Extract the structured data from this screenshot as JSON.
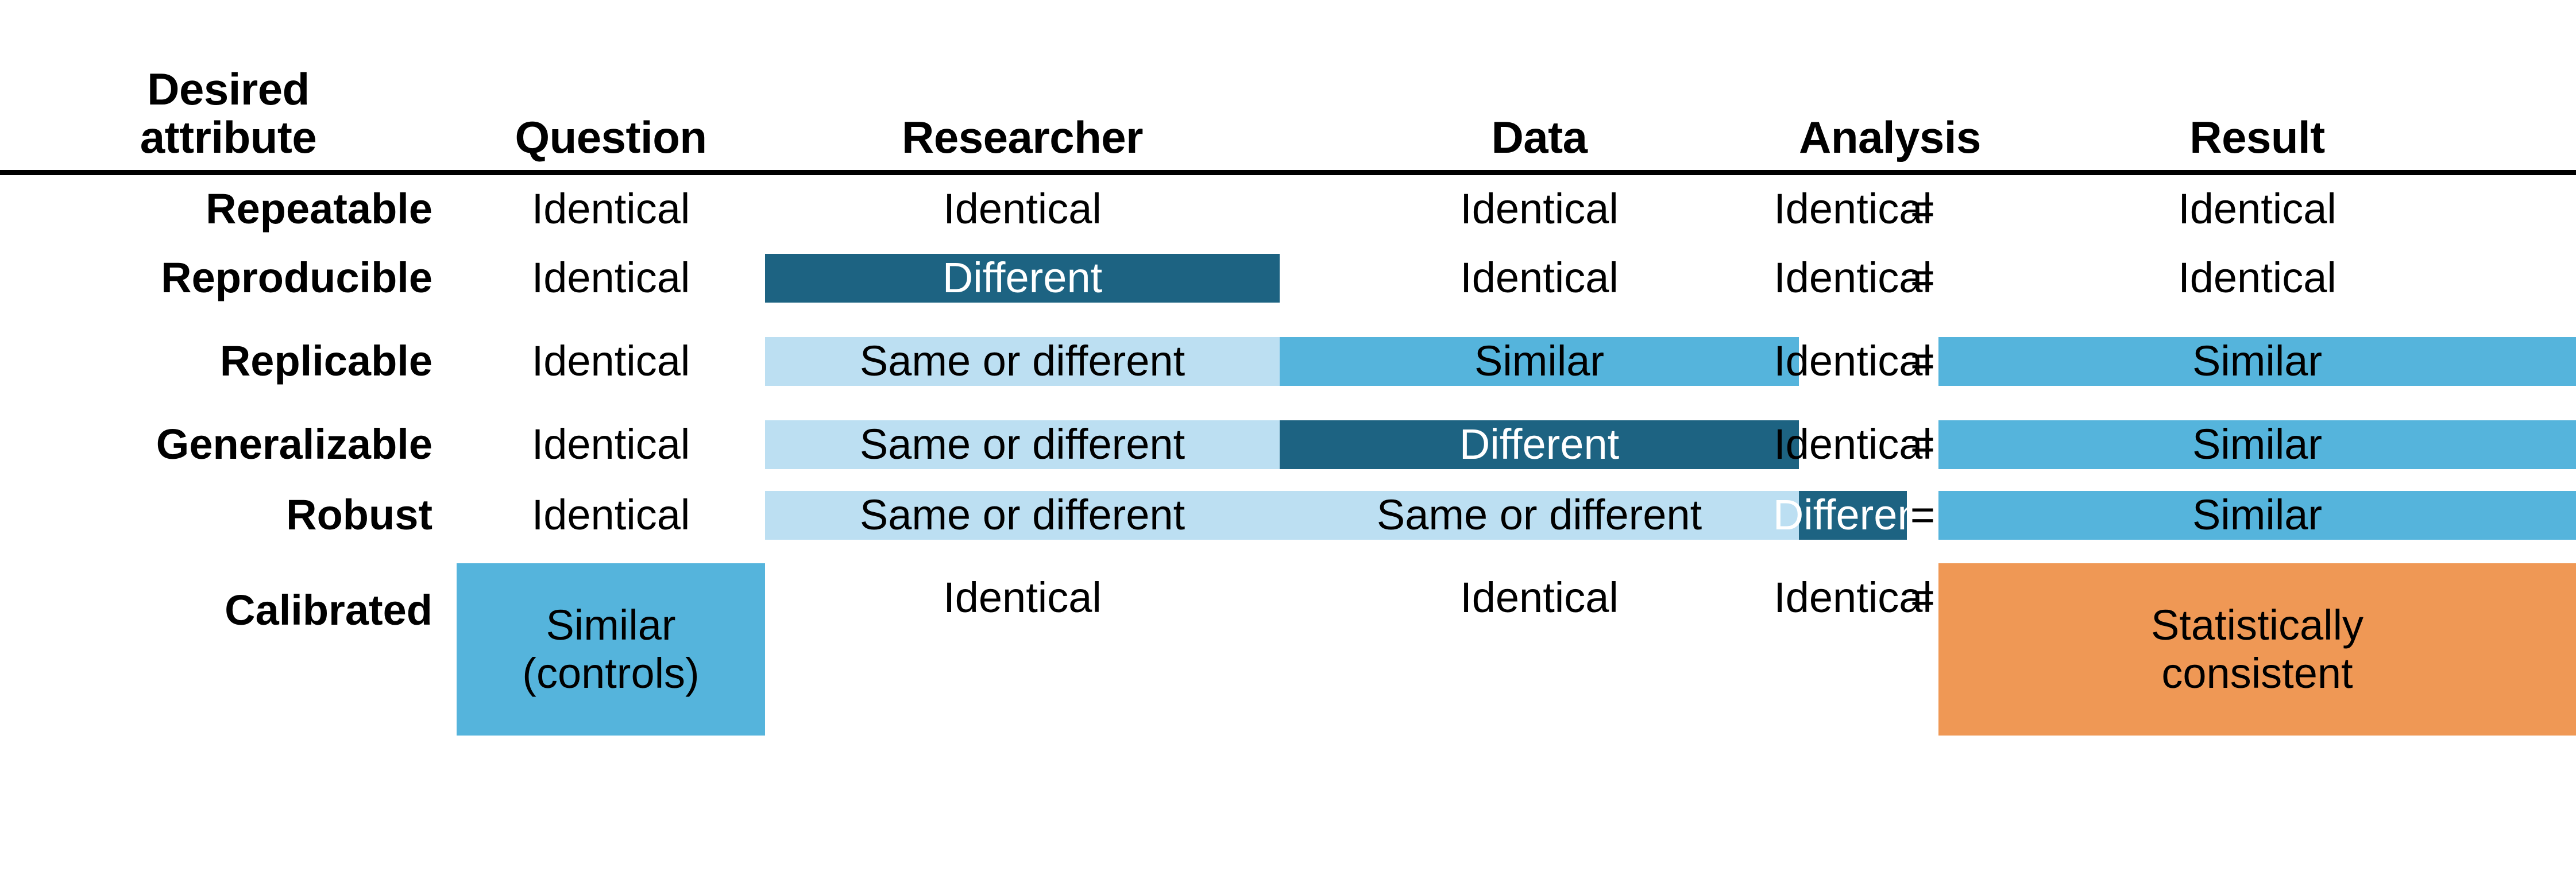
{
  "table": {
    "columns": [
      {
        "id": "attribute",
        "label": "Desired\nattribute",
        "label_line1": "Desired",
        "label_line2": "attribute"
      },
      {
        "id": "question",
        "label": "Question"
      },
      {
        "id": "researcher",
        "label": "Researcher"
      },
      {
        "id": "data",
        "label": "Data"
      },
      {
        "id": "analysis",
        "label": "Analysis"
      },
      {
        "id": "equals",
        "label": ""
      },
      {
        "id": "result",
        "label": "Result"
      }
    ],
    "equals_symbol": "=",
    "colors": {
      "dark_teal": "#1d6382",
      "medium_blue": "#55b4dc",
      "light_blue": "#bcdff2",
      "orange": "#ef9855",
      "text": "#000000",
      "text_on_dark": "#ffffff",
      "rule": "#000000",
      "background": "#ffffff"
    },
    "rows": [
      {
        "attribute": "Repeatable",
        "question": {
          "text": "Identical",
          "fill": "none"
        },
        "researcher": {
          "text": "Identical",
          "fill": "none"
        },
        "data": {
          "text": "Identical",
          "fill": "none"
        },
        "analysis": {
          "text": "Identical",
          "fill": "none"
        },
        "equals": "=",
        "result": {
          "text": "Identical",
          "fill": "none"
        }
      },
      {
        "attribute": "Reproducible",
        "question": {
          "text": "Identical",
          "fill": "none"
        },
        "researcher": {
          "text": "Different",
          "fill": "dark"
        },
        "data": {
          "text": "Identical",
          "fill": "none"
        },
        "analysis": {
          "text": "Identical",
          "fill": "none"
        },
        "equals": "=",
        "result": {
          "text": "Identical",
          "fill": "none"
        }
      },
      {
        "attribute": "Replicable",
        "question": {
          "text": "Identical",
          "fill": "none"
        },
        "researcher": {
          "text": "Same or different",
          "fill": "light"
        },
        "data": {
          "text": "Similar",
          "fill": "medium"
        },
        "analysis": {
          "text": "Identical",
          "fill": "none"
        },
        "equals": "=",
        "result": {
          "text": "Similar",
          "fill": "medium"
        }
      },
      {
        "attribute": "Generalizable",
        "question": {
          "text": "Identical",
          "fill": "none"
        },
        "researcher": {
          "text": "Same or different",
          "fill": "light"
        },
        "data": {
          "text": "Different",
          "fill": "dark"
        },
        "analysis": {
          "text": "Identical",
          "fill": "none"
        },
        "equals": "=",
        "result": {
          "text": "Similar",
          "fill": "medium"
        }
      },
      {
        "attribute": "Robust",
        "question": {
          "text": "Identical",
          "fill": "none"
        },
        "researcher": {
          "text": "Same or different",
          "fill": "light"
        },
        "data": {
          "text": "Same or different",
          "fill": "light"
        },
        "analysis": {
          "text": "Different",
          "fill": "dark"
        },
        "equals": "=",
        "result": {
          "text": "Similar",
          "fill": "medium"
        }
      },
      {
        "attribute": "Calibrated",
        "question": {
          "text": "Similar\n(controls)",
          "line1": "Similar",
          "line2": "(controls)",
          "fill": "medium",
          "multiline": true
        },
        "researcher": {
          "text": "Identical",
          "fill": "none"
        },
        "data": {
          "text": "Identical",
          "fill": "none"
        },
        "analysis": {
          "text": "Identical",
          "fill": "none"
        },
        "equals": "=",
        "result": {
          "text": "Statistically\nconsistent",
          "line1": "Statistically",
          "line2": "consistent",
          "fill": "orange",
          "multiline": true
        }
      }
    ]
  }
}
